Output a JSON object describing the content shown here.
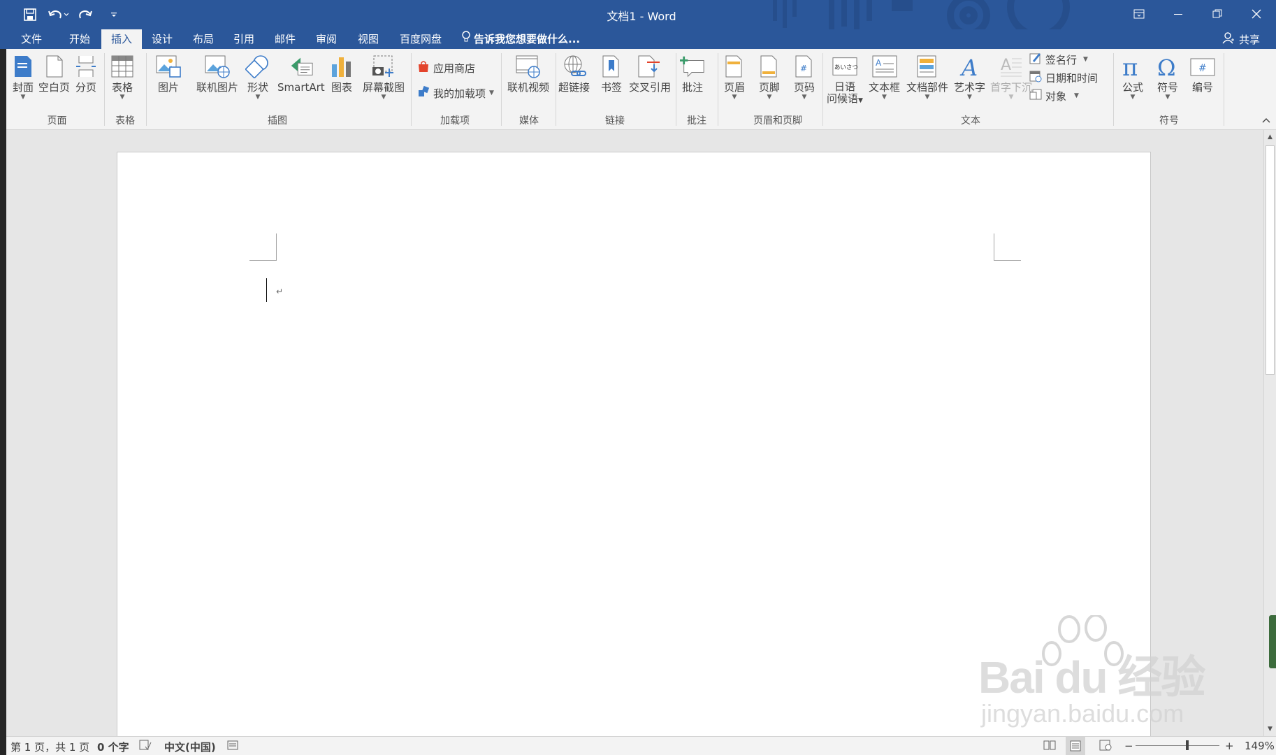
{
  "window": {
    "title": "文档1 - Word"
  },
  "tabs": [
    {
      "label": "文件"
    },
    {
      "label": "开始"
    },
    {
      "label": "插入",
      "active": true
    },
    {
      "label": "设计"
    },
    {
      "label": "布局"
    },
    {
      "label": "引用"
    },
    {
      "label": "邮件"
    },
    {
      "label": "审阅"
    },
    {
      "label": "视图"
    },
    {
      "label": "百度网盘"
    }
  ],
  "tell_me": "告诉我您想要做什么...",
  "share_label": "共享",
  "ribbon": {
    "groups": {
      "pages": "页面",
      "tables": "表格",
      "illustrations": "插图",
      "addins": "加载项",
      "media": "媒体",
      "links": "链接",
      "comments": "批注",
      "header_footer": "页眉和页脚",
      "text": "文本",
      "symbols": "符号"
    },
    "buttons": {
      "cover": "封面",
      "blank_page": "空白页",
      "page_break": "分页",
      "table": "表格",
      "picture": "图片",
      "online_picture": "联机图片",
      "shapes": "形状",
      "smartart": "SmartArt",
      "chart": "图表",
      "screenshot": "屏幕截图",
      "store": "应用商店",
      "my_addins": "我的加载项",
      "online_video": "联机视频",
      "hyperlink": "超链接",
      "bookmark": "书签",
      "cross_ref": "交叉引用",
      "comment": "批注",
      "header": "页眉",
      "footer": "页脚",
      "page_number": "页码",
      "greeting_line1": "日语",
      "greeting_line2": "问候语",
      "greeting_icon_text": "あいさつ",
      "text_box": "文本框",
      "quick_parts": "文档部件",
      "wordart": "艺术字",
      "drop_cap": "首字下沉",
      "signature_line": "签名行",
      "date_time": "日期和时间",
      "object": "对象",
      "equation": "公式",
      "symbol": "符号",
      "numbering": "编号"
    }
  },
  "document": {
    "paragraph_mark": "↵"
  },
  "statusbar": {
    "page_info": "第 1 页，共 1 页",
    "word_count": "0 个字",
    "language": "中文(中国)",
    "zoom_minus": "−",
    "zoom_plus": "+",
    "zoom_level": "149%",
    "zoom_fraction": 0.62
  },
  "watermark": {
    "brand": "Bai du 经验",
    "url": "jingyan.baidu.com"
  },
  "colors": {
    "accent": "#2b579a",
    "ribbon_bg": "#f3f3f3",
    "canvas_bg": "#e6e6e6"
  }
}
